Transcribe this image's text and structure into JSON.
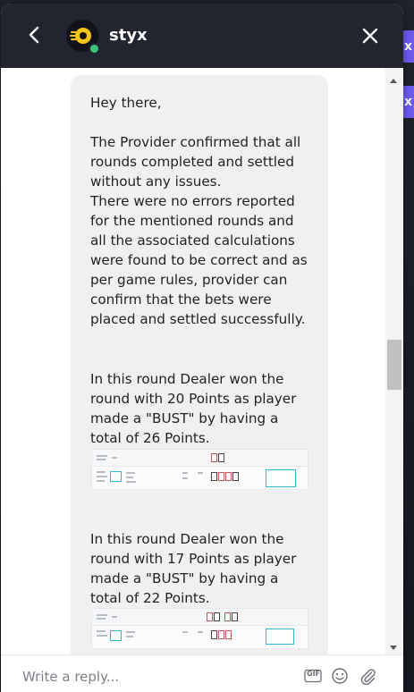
{
  "header": {
    "agent_name": "styx",
    "back_icon": "chevron-left-icon",
    "close_icon": "close-icon",
    "accent": "#f5c518"
  },
  "messages": {
    "paragraph_1": "Hey there,\n\nThe Provider confirmed that all rounds completed and settled without any issues.\nThere were no errors reported for the mentioned rounds and all the associated calculations were found to be correct and as per game rules, provider can confirm that the bets were placed and settled successfully.",
    "paragraph_2": "In this round Dealer won the round with 20 Points as player made a \"BUST\" by having a total of 26 Points.",
    "paragraph_3": "In this round Dealer won the round with 17 Points as player made a \"BUST\" by having a total of 22 Points."
  },
  "composer": {
    "placeholder": "Write a reply...",
    "gif_label": "GIF",
    "emoji_icon": "smiley-icon",
    "attach_icon": "paperclip-icon"
  }
}
